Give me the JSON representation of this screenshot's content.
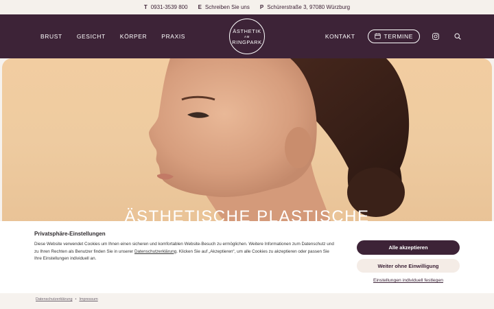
{
  "topbar": {
    "phone": {
      "key": "T",
      "value": "0931-3539 800"
    },
    "email": {
      "key": "E",
      "value": "Schreiben Sie uns"
    },
    "address": {
      "key": "P",
      "value": "Schürerstraße 3, 97080 Würzburg"
    }
  },
  "nav": {
    "left": [
      "BRUST",
      "GESICHT",
      "KÖRPER",
      "PRAXIS"
    ],
    "kontakt": "KONTAKT",
    "termine": "TERMINE"
  },
  "logo": {
    "line1": "ÄSTHETIK",
    "line2": "AM",
    "line3": "RINGPARK"
  },
  "hero": {
    "title": "ÄSTHETISCHE PLASTISCHE"
  },
  "cookie": {
    "title": "Privatsphäre-Einstellungen",
    "text_before": "Diese Website verwendet Cookies um Ihnen einen sicheren und komfortablen Website-Besuch zu ermöglichen. Weitere Informationen zum Datenschutz und zu Ihren Rechten als Benutzer finden Sie in unserer ",
    "text_link": "Datenschutzerklärung",
    "text_after": ". Klicken Sie auf „Akzeptieren“, um alle Cookies zu akzeptieren oder passen Sie Ihre Einstellungen individuell an.",
    "accept": "Alle akzeptieren",
    "reject": "Weiter ohne Einwilligung",
    "settings": "Einstellungen individuell festlegen"
  },
  "footer": {
    "privacy": "Datenschutzerklärung",
    "separator": "•",
    "imprint": "Impressum"
  },
  "icons": [
    "calendar-icon",
    "instagram-icon",
    "search-icon"
  ],
  "colors": {
    "brand": "#3d2337",
    "hero_bg": "#f0cba0",
    "topbar_bg": "#f5f1ec"
  }
}
